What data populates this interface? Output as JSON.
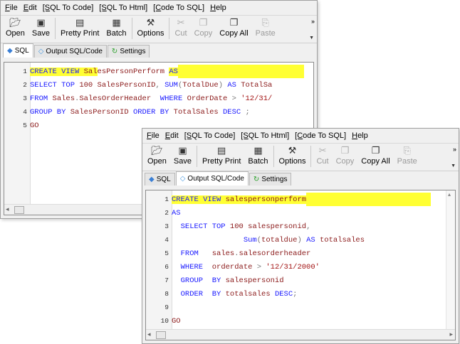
{
  "menu": [
    "File",
    "Edit",
    "[SQL To Code]",
    "[SQL To Html]",
    "[Code To SQL]",
    "Help"
  ],
  "toolbar": {
    "open": "Open",
    "save": "Save",
    "pretty_print": "Pretty Print",
    "batch": "Batch",
    "options": "Options",
    "cut": "Cut",
    "copy": "Copy",
    "copy_all": "Copy All",
    "paste": "Paste",
    "more": "»",
    "icons": {
      "open": "open-folder-icon",
      "save": "floppy-disk-icon",
      "pretty_print": "pretty-print-icon",
      "batch": "batch-icon",
      "options": "options-tool-icon",
      "cut": "scissors-icon",
      "copy": "copy-icon",
      "copy_all": "copy-all-icon",
      "paste": "paste-icon"
    }
  },
  "tabs": [
    "SQL",
    "Output SQL/Code",
    "Settings"
  ],
  "window1": {
    "active_tab": "SQL",
    "lines": [
      {
        "n": "1",
        "parts": [
          [
            "CREATE VIEW ",
            "kw hl"
          ],
          [
            "Sal",
            "id hl"
          ],
          [
            "esPersonPerform ",
            "id"
          ],
          [
            "AS",
            "kw hl"
          ]
        ],
        "tail": true
      },
      {
        "n": "2",
        "parts": [
          [
            "SELECT TOP ",
            "kw"
          ],
          [
            "100 ",
            "id"
          ],
          [
            "SalesPersonID",
            "id"
          ],
          [
            ", ",
            "op"
          ],
          [
            "SUM",
            "kw"
          ],
          [
            "(",
            "op"
          ],
          [
            "TotalDue",
            "id"
          ],
          [
            ") ",
            "op"
          ],
          [
            "AS ",
            "kw"
          ],
          [
            "TotalSa",
            "id"
          ]
        ]
      },
      {
        "n": "3",
        "parts": [
          [
            "FROM ",
            "kw"
          ],
          [
            "Sales",
            "id"
          ],
          [
            ".",
            "op"
          ],
          [
            "SalesOrderHeader  ",
            "id"
          ],
          [
            "WHERE ",
            "kw"
          ],
          [
            "OrderDate ",
            "id"
          ],
          [
            "> ",
            "op"
          ],
          [
            "'12/31/",
            "str"
          ]
        ]
      },
      {
        "n": "4",
        "parts": [
          [
            "GROUP BY ",
            "kw"
          ],
          [
            "SalesPersonID ",
            "id"
          ],
          [
            "ORDER BY ",
            "kw"
          ],
          [
            "TotalSales ",
            "id"
          ],
          [
            "DESC ",
            "kw"
          ],
          [
            ";",
            "op"
          ]
        ]
      },
      {
        "n": "5",
        "parts": [
          [
            "GO",
            "id"
          ]
        ]
      }
    ]
  },
  "window2": {
    "active_tab": "Output SQL/Code",
    "lines": [
      {
        "n": "1",
        "parts": [
          [
            "CREATE VIEW ",
            "kw hl"
          ],
          [
            "salespersonperform",
            "id hl"
          ]
        ],
        "tail": true
      },
      {
        "n": "2",
        "parts": [
          [
            "AS",
            "kw"
          ]
        ]
      },
      {
        "n": "3",
        "parts": [
          [
            "  SELECT TOP ",
            "kw"
          ],
          [
            "100 ",
            "id"
          ],
          [
            "salespersonid",
            "id"
          ],
          [
            ",",
            "op"
          ]
        ]
      },
      {
        "n": "4",
        "parts": [
          [
            "                ",
            "op"
          ],
          [
            "Sum",
            "kw"
          ],
          [
            "(",
            "op"
          ],
          [
            "totaldue",
            "id"
          ],
          [
            ") ",
            "op"
          ],
          [
            "AS ",
            "kw"
          ],
          [
            "totalsales",
            "id"
          ]
        ]
      },
      {
        "n": "5",
        "parts": [
          [
            "  FROM   ",
            "kw"
          ],
          [
            "sales",
            "id"
          ],
          [
            ".",
            "op"
          ],
          [
            "salesorderheader",
            "id"
          ]
        ]
      },
      {
        "n": "6",
        "parts": [
          [
            "  WHERE  ",
            "kw"
          ],
          [
            "orderdate ",
            "id"
          ],
          [
            "> ",
            "op"
          ],
          [
            "'12/31/2000'",
            "str"
          ]
        ]
      },
      {
        "n": "7",
        "parts": [
          [
            "  GROUP  BY ",
            "kw"
          ],
          [
            "salespersonid",
            "id"
          ]
        ]
      },
      {
        "n": "8",
        "parts": [
          [
            "  ORDER  BY ",
            "kw"
          ],
          [
            "totalsales ",
            "id"
          ],
          [
            "DESC",
            "kw"
          ],
          [
            ";",
            "op"
          ]
        ]
      },
      {
        "n": "9",
        "parts": []
      },
      {
        "n": "10",
        "parts": [
          [
            "GO",
            "id"
          ]
        ]
      }
    ]
  },
  "colors": {
    "keyword": "#1a1aff",
    "identifier": "#8b1a1a",
    "string": "#a31515",
    "highlight": "#ffff33"
  }
}
